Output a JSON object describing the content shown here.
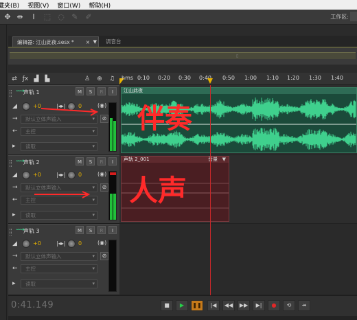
{
  "menu": [
    "藏夹(B)",
    "视图(V)",
    "窗口(W)",
    "帮助(H)"
  ],
  "toolbar": {
    "workspace_label": "工作区:"
  },
  "tabs": {
    "active": "编辑器: 江山此夜.sesx *",
    "active_close": "×",
    "active_menu": "▼",
    "inactive": "调音台"
  },
  "ruler": {
    "unit": "hms",
    "ticks": [
      "0:10",
      "0:20",
      "0:30",
      "0:40",
      "0:50",
      "1:00",
      "1:10",
      "1:20",
      "1:30",
      "1:40"
    ]
  },
  "tracks": [
    {
      "name": "声轨 1",
      "volume": "+0",
      "pan": "0",
      "input": "默认立体声输入",
      "output": "主控",
      "read": "读取",
      "clip_title": "江山此夜"
    },
    {
      "name": "声轨 2",
      "volume": "+0",
      "pan": "0",
      "input": "默认立体声输入",
      "output": "主控",
      "read": "读取",
      "clip_title": "声轨 2_001",
      "clip_tag": "音量"
    },
    {
      "name": "声轨 3",
      "volume": "+0",
      "pan": "0",
      "input": "默认立体声输入",
      "output": "主控",
      "read": "读取"
    }
  ],
  "buttons": {
    "mute": "M",
    "solo": "S",
    "record": "R",
    "input_monitor": "I"
  },
  "transport": {
    "timecode": "0:41.149"
  },
  "annotations": {
    "accompaniment": "伴奏",
    "vocals": "人声"
  },
  "colors": {
    "waveform": "#3fd08d",
    "playhead": "#c8282a",
    "accent": "#e8b200",
    "annotation": "#ff2a2a"
  }
}
